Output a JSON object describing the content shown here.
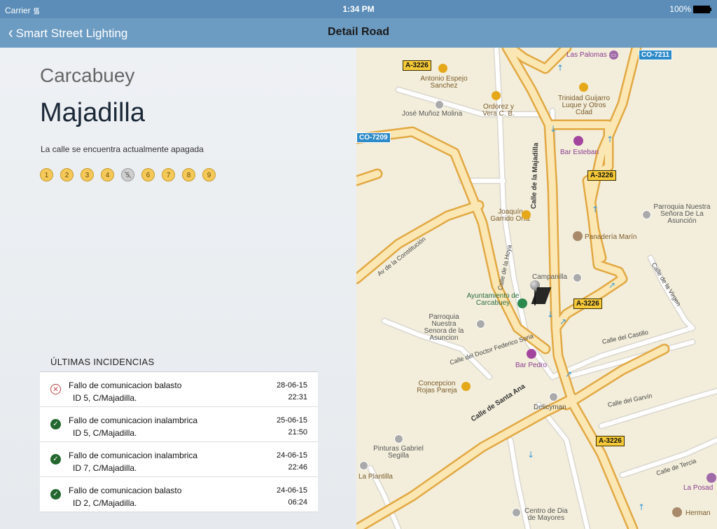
{
  "status_bar": {
    "carrier": "Carrier",
    "time": "1:34 PM",
    "battery": "100%"
  },
  "nav": {
    "back_label": "Smart Street Lighting",
    "title": "Detail Road"
  },
  "detail": {
    "city": "Carcabuey",
    "street": "Majadilla",
    "status": "La calle se encuentra actualmente apagada",
    "lamps": [
      {
        "label": "1",
        "state": "on"
      },
      {
        "label": "2",
        "state": "on"
      },
      {
        "label": "3",
        "state": "on"
      },
      {
        "label": "4",
        "state": "on"
      },
      {
        "label": "5",
        "state": "off"
      },
      {
        "label": "6",
        "state": "on"
      },
      {
        "label": "7",
        "state": "on"
      },
      {
        "label": "8",
        "state": "on"
      },
      {
        "label": "9",
        "state": "on"
      }
    ]
  },
  "incidents": {
    "header": "ÚLTIMAS INCIDENCIAS",
    "items": [
      {
        "status": "error",
        "title": "Fallo de comunicacion balasto",
        "subtitle": "ID 5, C/Majadilla.",
        "date": "28-06-15",
        "time": "22:31"
      },
      {
        "status": "ok",
        "title": "Fallo de comunicacion inalambrica",
        "subtitle": "ID 5, C/Majadilla.",
        "date": "25-06-15",
        "time": "21:50"
      },
      {
        "status": "ok",
        "title": "Fallo de comunicacion inalambrica",
        "subtitle": "ID 7, C/Majadilla.",
        "date": "24-06-15",
        "time": "22:46"
      },
      {
        "status": "ok",
        "title": "Fallo de comunicacion balasto",
        "subtitle": "ID 2, C/Majadilla.",
        "date": "24-06-15",
        "time": "06:24"
      }
    ]
  },
  "map": {
    "shields": [
      "A-3226",
      "CO-7211",
      "CO-7209"
    ],
    "streets": [
      "Calle de la Majadilla",
      "Av de la Constitución",
      "Calle de la Hoya",
      "Calle del Doctor Federico Soria",
      "Calle de Santa Ana",
      "Calle del Castillo",
      "Calle del Garvín",
      "Calle de Tercia",
      "Calle de la Virgen"
    ],
    "pois": [
      {
        "name": "Las Palomas",
        "color": "purple"
      },
      {
        "name": "Antonio Espejo Sanchez",
        "color": "brown"
      },
      {
        "name": "Ordorez y Vera C. B.",
        "color": "brown"
      },
      {
        "name": "Trinidad Guijarro Luque y Otros Cdad",
        "color": "brown"
      },
      {
        "name": "José Muñoz Molina",
        "color": "gray"
      },
      {
        "name": "Bar Esteban",
        "color": "purple"
      },
      {
        "name": "Joaquín Garrido Ortiz",
        "color": "brown"
      },
      {
        "name": "Parroquia Nuestra Señora De La Asunción",
        "color": "gray"
      },
      {
        "name": "Panadería Marín",
        "color": "brown"
      },
      {
        "name": "Campanilla",
        "color": "gray"
      },
      {
        "name": "Ayuntamiento de Carcabuey",
        "color": "green"
      },
      {
        "name": "Parroquia Nuestra Senora de la Asuncion",
        "color": "gray"
      },
      {
        "name": "Bar Pedro",
        "color": "purple"
      },
      {
        "name": "Concepcion Rojas Pareja",
        "color": "brown"
      },
      {
        "name": "Delicyman",
        "color": "gray"
      },
      {
        "name": "Pinturas Gabriel Segilla",
        "color": "gray"
      },
      {
        "name": "La Plantilla",
        "color": "brown"
      },
      {
        "name": "La Posad",
        "color": "purple"
      },
      {
        "name": "Centro de Dia de Mayores",
        "color": "gray"
      },
      {
        "name": "Herman",
        "color": "brown"
      }
    ]
  }
}
